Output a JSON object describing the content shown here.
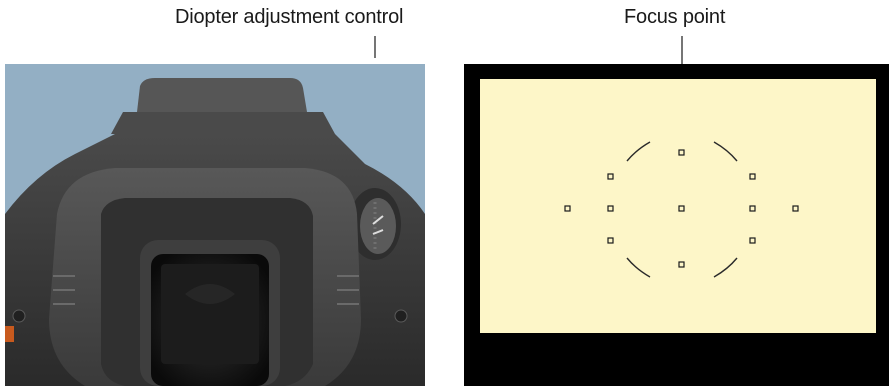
{
  "annotations": {
    "diopter_label": "Diopter adjustment control",
    "focus_label": "Focus point"
  },
  "viewfinder": {
    "screen_color": "#fdf6c8",
    "focus_point_count": 11
  },
  "camera_photo": {
    "sky_color": "#93afc4",
    "body_color": "#3c3c3c"
  }
}
